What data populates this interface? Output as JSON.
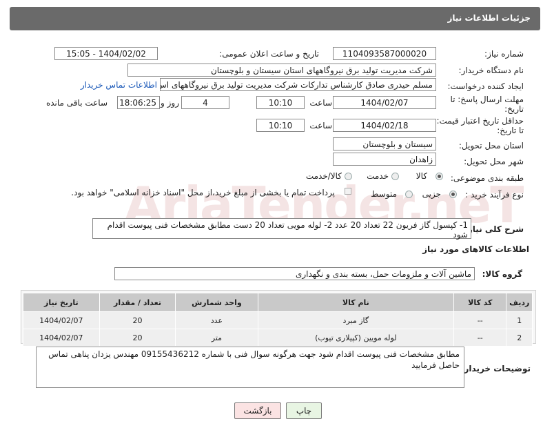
{
  "header": {
    "title": "جزئیات اطلاعات نیاز"
  },
  "form": {
    "need_number_label": "شماره نیاز:",
    "need_number": "1104093587000020",
    "announce_label": "تاریخ و ساعت اعلان عمومی:",
    "announce_value": "1404/02/02 - 15:05",
    "buyer_org_label": "نام دستگاه خریدار:",
    "buyer_org": "شرکت مدیریت تولید برق نیروگاههای استان سیستان و بلوچستان",
    "creator_label": "ایجاد کننده درخواست:",
    "creator": "مسلم حیدری صادق کارشناس تدارکات شرکت مدیریت تولید برق نیروگاههای اس",
    "contact_link": "اطلاعات تماس خریدار",
    "deadline_label_1": "مهلت ارسال پاسخ: تا",
    "deadline_label_2": "تاریخ:",
    "deadline_date": "1404/02/07",
    "time_label": "ساعت",
    "deadline_time": "10:10",
    "days_value": "4",
    "days_label": "روز و",
    "remaining_time": "18:06:25",
    "remaining_label": "ساعت باقی مانده",
    "validity_label_1": "حداقل تاریخ اعتبار قیمت:",
    "validity_label_2": "تا تاریخ:",
    "validity_date": "1404/02/18",
    "validity_time": "10:10",
    "province_label": "استان محل تحویل:",
    "province": "سیستان و بلوچستان",
    "city_label": "شهر محل تحویل:",
    "city": "زاهدان",
    "category_label": "طبقه بندی موضوعی:",
    "category_options": [
      "کالا",
      "خدمت",
      "کالا/خدمت"
    ],
    "process_label": "نوع فرآیند خرید :",
    "process_options": [
      "جزیی",
      "متوسط"
    ],
    "payment_note": "پرداخت تمام یا بخشی از مبلغ خرید،از محل \"اسناد خزانه اسلامی\" خواهد بود."
  },
  "summary": {
    "label": "شرح کلی نیاز:",
    "text": "1- کپسول گاز فریون 22 تعداد 20 عدد 2- لوله مویی  تعداد  20 دست مطابق مشخصات فنی پیوست اقدام شود"
  },
  "goods": {
    "section_title": "اطلاعات کالاهای مورد نیاز",
    "group_label": "گروه کالا:",
    "group_value": "ماشین آلات و ملزومات حمل، بسته بندی و نگهداری",
    "columns": [
      "ردیف",
      "کد کالا",
      "نام کالا",
      "واحد شمارش",
      "تعداد / مقدار",
      "تاریخ نیاز"
    ],
    "rows": [
      [
        "1",
        "--",
        "گاز مبرد",
        "عدد",
        "20",
        "1404/02/07"
      ],
      [
        "2",
        "--",
        "لوله مویین (کپیلاری تیوب)",
        "متر",
        "20",
        "1404/02/07"
      ]
    ]
  },
  "buyer_notes": {
    "label": "توضیحات خریدار:",
    "text": "مطابق مشخصات فنی پیوست اقدام شود  جهت هرگونه سوال فنی با شماره 09155436212 مهندس یزدان پناهی تماس حاصل فرمایید"
  },
  "buttons": {
    "print": "چاپ",
    "back": "بازگشت"
  },
  "watermark": {
    "text": "AriaTender.neT",
    "color": "#f2dede"
  }
}
